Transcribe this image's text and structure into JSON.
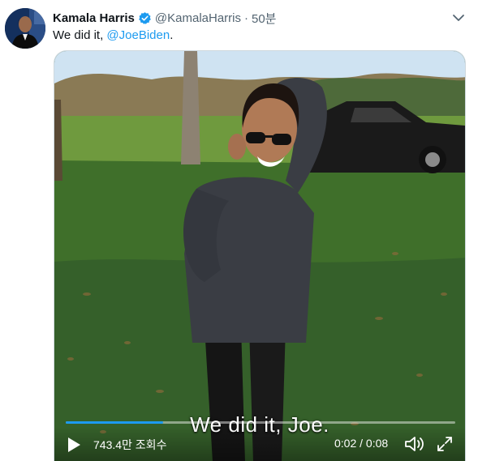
{
  "tweet": {
    "author_name": "Kamala Harris",
    "handle": "@KamalaHarris",
    "separator": "·",
    "time": "50분",
    "text_prefix": "We did it, ",
    "mention": "@JoeBiden",
    "text_suffix": ".",
    "verified_badge_icon": "verified-badge-icon",
    "more_icon": "chevron-down-icon"
  },
  "video": {
    "caption": "We did it, Joe.",
    "views": "743.4만 조회수",
    "timecode": "0:02 / 0:08",
    "progress": 0.25,
    "icons": {
      "play": "play-icon",
      "volume": "volume-icon",
      "fullscreen": "fullscreen-icon"
    }
  },
  "colors": {
    "accent": "#1d9bf0",
    "text": "#0f1419",
    "secondary_text": "#536471"
  }
}
